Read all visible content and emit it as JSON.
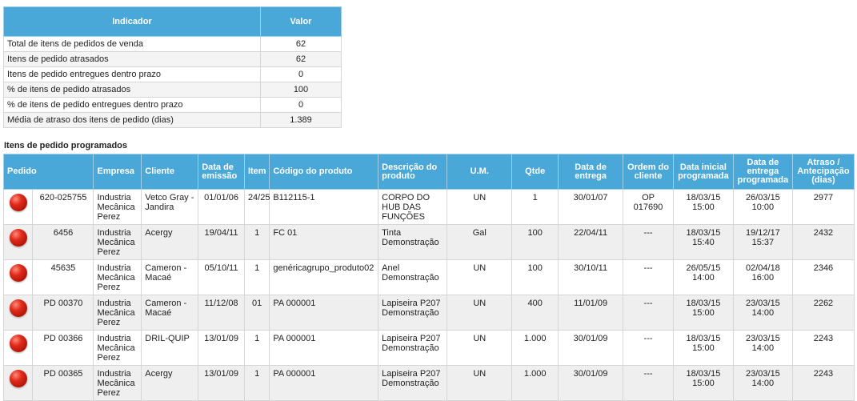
{
  "indicators": {
    "header": {
      "indicador": "Indicador",
      "valor": "Valor"
    },
    "rows": [
      {
        "label": "Total de itens de pedidos de venda",
        "value": "62"
      },
      {
        "label": "Itens de pedido atrasados",
        "value": "62"
      },
      {
        "label": "Itens de pedido entregues dentro prazo",
        "value": "0"
      },
      {
        "label": "% de itens de pedido atrasados",
        "value": "100"
      },
      {
        "label": "% de itens de pedido entregues dentro prazo",
        "value": "0"
      },
      {
        "label": "Média de atraso dos itens de pedido (dias)",
        "value": "1.389"
      }
    ]
  },
  "section_title": "Itens de pedido programados",
  "columns": {
    "pedido": "Pedido",
    "empresa": "Empresa",
    "cliente": "Cliente",
    "data_emissao": "Data de emissão",
    "item": "Item",
    "codigo": "Código do produto",
    "descricao": "Descrição do produto",
    "um": "U.M.",
    "qtde": "Qtde",
    "data_entrega": "Data de entrega",
    "ordem": "Ordem do cliente",
    "data_inicial": "Data inicial programada",
    "data_entrega_prog": "Data de entrega programada",
    "atraso": "Atraso / Antecipação (dias)"
  },
  "status_color": "#d9261a",
  "rows": [
    {
      "pedido": "620-025755",
      "empresa": "Industria Mecânica Perez",
      "cliente": "Vetco Gray - Jandira",
      "emissao": "01/01/06",
      "item": "24/25",
      "codigo": "B112115-1",
      "descricao": "CORPO DO HUB DAS FUNÇÕES",
      "um": "UN",
      "qtde": "1",
      "entrega": "30/01/07",
      "ordem": "OP 017690",
      "inicial": "18/03/15 15:00",
      "entrega_prog": "26/03/15 10:00",
      "atraso": "2977"
    },
    {
      "pedido": "6456",
      "empresa": "Industria Mecânica Perez",
      "cliente": "Acergy",
      "emissao": "19/04/11",
      "item": "1",
      "codigo": "FC 01",
      "descricao": "Tinta Demonstração",
      "um": "Gal",
      "qtde": "100",
      "entrega": "22/04/11",
      "ordem": "---",
      "inicial": "18/03/15 15:40",
      "entrega_prog": "19/12/17 15:37",
      "atraso": "2432"
    },
    {
      "pedido": "45635",
      "empresa": "Industria Mecânica Perez",
      "cliente": "Cameron - Macaé",
      "emissao": "05/10/11",
      "item": "1",
      "codigo": "genéricagrupo_produto02",
      "descricao": "Anel Demonstração",
      "um": "UN",
      "qtde": "100",
      "entrega": "30/10/11",
      "ordem": "---",
      "inicial": "26/05/15 14:00",
      "entrega_prog": "02/04/18 16:00",
      "atraso": "2346"
    },
    {
      "pedido": "PD 00370",
      "empresa": "Industria Mecânica Perez",
      "cliente": "Cameron - Macaé",
      "emissao": "11/12/08",
      "item": "01",
      "codigo": "PA 000001",
      "descricao": "Lapiseira P207 Demonstração",
      "um": "UN",
      "qtde": "400",
      "entrega": "11/01/09",
      "ordem": "---",
      "inicial": "18/03/15 15:00",
      "entrega_prog": "23/03/15 14:00",
      "atraso": "2262"
    },
    {
      "pedido": "PD 00366",
      "empresa": "Industria Mecânica Perez",
      "cliente": "DRIL-QUIP",
      "emissao": "13/01/09",
      "item": "1",
      "codigo": "PA 000001",
      "descricao": "Lapiseira P207 Demonstração",
      "um": "UN",
      "qtde": "1.000",
      "entrega": "30/01/09",
      "ordem": "---",
      "inicial": "18/03/15 15:00",
      "entrega_prog": "23/03/15 14:00",
      "atraso": "2243"
    },
    {
      "pedido": "PD 00365",
      "empresa": "Industria Mecânica Perez",
      "cliente": "Acergy",
      "emissao": "13/01/09",
      "item": "1",
      "codigo": "PA 000001",
      "descricao": "Lapiseira P207 Demonstração",
      "um": "UN",
      "qtde": "1.000",
      "entrega": "30/01/09",
      "ordem": "---",
      "inicial": "18/03/15 15:00",
      "entrega_prog": "23/03/15 14:00",
      "atraso": "2243"
    }
  ]
}
